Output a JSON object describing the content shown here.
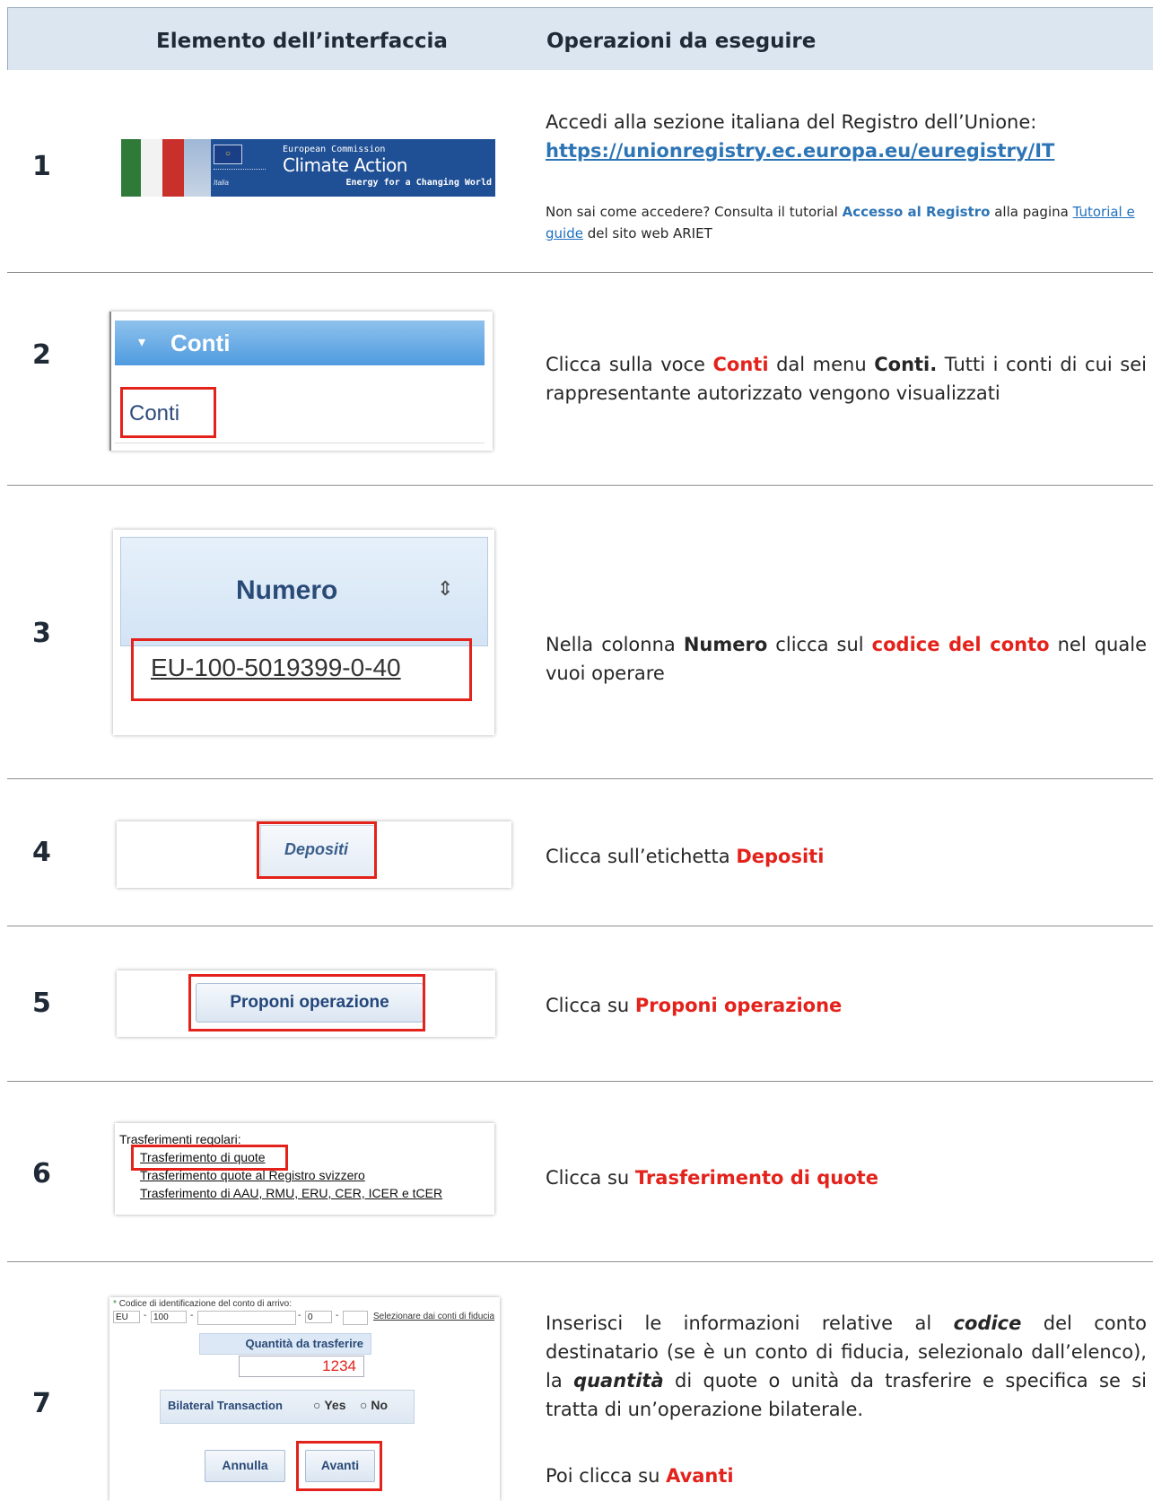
{
  "header": {
    "col1": "Elemento dell’interfaccia",
    "col2": "Operazioni da eseguire"
  },
  "colors": {
    "accent": "#e3221b",
    "link": "#1f6fbf",
    "header_bg": "#dbe6f1"
  },
  "steps": [
    {
      "num": "1",
      "text_a": "Accedi alla sezione italiana del Registro dell’Unione:",
      "url": "https://unionregistry.ec.europa.eu/euregistry/IT",
      "note_a": "Non sai come accedere? Consulta il tutorial ",
      "note_link1": "Accesso al Registro",
      "note_b": " alla pagina ",
      "note_link2": "Tutorial e guide",
      "note_c": " del sito web ARIET",
      "banner": {
        "line1": "European Commission",
        "line2": "Climate Action",
        "line3": "Energy for a Changing World",
        "country": "Italia"
      }
    },
    {
      "num": "2",
      "t1": "Clicca sulla voce ",
      "t2": "Conti",
      "t3": " dal menu ",
      "t4": "Conti.",
      "t5": " Tutti i conti di cui sei rappresentante autorizzato vengono visualizzati",
      "menu_header": "Conti",
      "menu_item": "Conti"
    },
    {
      "num": "3",
      "t1": "Nella colonna ",
      "t2": "Numero",
      "t3": " clicca sul ",
      "t4": "codice del conto",
      "t5": " nel quale vuoi operare",
      "col_header": "Numero",
      "account": "EU-100-5019399-0-40"
    },
    {
      "num": "4",
      "t1": "Clicca sull’etichetta ",
      "t2": "Depositi",
      "tab": "Depositi"
    },
    {
      "num": "5",
      "t1": "Clicca su ",
      "t2": "Proponi operazione",
      "button": "Proponi operazione"
    },
    {
      "num": "6",
      "t1": "Clicca su ",
      "t2": "Trasferimento di quote",
      "list_title": "Trasferimenti regolari:",
      "items": [
        "Trasferimento di quote",
        "Trasferimento quote al Registro svizzero",
        "Trasferimento di AAU, RMU, ERU, CER, ICER e tCER"
      ]
    },
    {
      "num": "7",
      "t1": "Inserisci le informazioni relative al ",
      "t2": "codice",
      "t3": " del conto destinatario (se è un conto di fiducia, selezionalo dall’elenco), la ",
      "t4": "quantità",
      "t5": " di quote o unità da trasferire e specifica se si tratta di un’operazione bilaterale.",
      "t6": "Poi clicca su ",
      "t7": "Avanti",
      "form": {
        "code_label": "Codice di identificazione del conto di arrivo:",
        "f1": "EU",
        "f2": "100",
        "f3": "",
        "f4": "0",
        "f5": "",
        "trust_link": "Selezionare dai conti di fiducia",
        "qty_label": "Quantità da trasferire",
        "qty_value": "1234",
        "bilateral_label": "Bilateral Transaction",
        "yes": "Yes",
        "no": "No",
        "cancel": "Annulla",
        "next": "Avanti"
      }
    }
  ]
}
